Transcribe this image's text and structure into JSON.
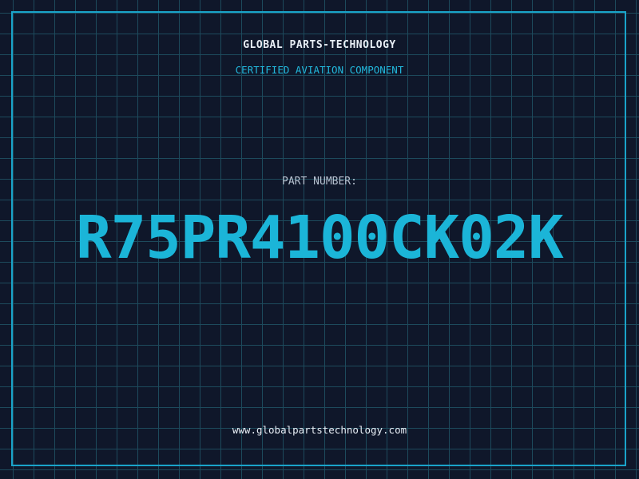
{
  "header": {
    "company": "GLOBAL PARTS-TECHNOLOGY",
    "subtitle": "CERTIFIED AVIATION COMPONENT"
  },
  "part": {
    "label": "PART NUMBER:",
    "number": "R75PR4100CK02K"
  },
  "footer": {
    "website": "www.globalpartstechnology.com"
  },
  "colors": {
    "background": "#0f172a",
    "grid": "#1d4a5c",
    "accent": "#1bb5d8",
    "text": "#e8eef5",
    "label": "#b6c1cf"
  }
}
